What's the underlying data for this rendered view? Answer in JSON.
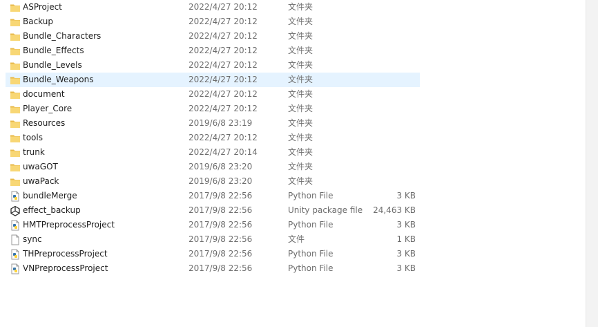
{
  "files": [
    {
      "name": "ASProject",
      "date": "2022/4/27 20:12",
      "type": "文件夹",
      "size": "",
      "icon": "folder-icon",
      "selected": false
    },
    {
      "name": "Backup",
      "date": "2022/4/27 20:12",
      "type": "文件夹",
      "size": "",
      "icon": "folder-icon",
      "selected": false
    },
    {
      "name": "Bundle_Characters",
      "date": "2022/4/27 20:12",
      "type": "文件夹",
      "size": "",
      "icon": "folder-icon",
      "selected": false
    },
    {
      "name": "Bundle_Effects",
      "date": "2022/4/27 20:12",
      "type": "文件夹",
      "size": "",
      "icon": "folder-icon",
      "selected": false
    },
    {
      "name": "Bundle_Levels",
      "date": "2022/4/27 20:12",
      "type": "文件夹",
      "size": "",
      "icon": "folder-icon",
      "selected": false
    },
    {
      "name": "Bundle_Weapons",
      "date": "2022/4/27 20:12",
      "type": "文件夹",
      "size": "",
      "icon": "folder-icon",
      "selected": true
    },
    {
      "name": "document",
      "date": "2022/4/27 20:12",
      "type": "文件夹",
      "size": "",
      "icon": "folder-icon",
      "selected": false
    },
    {
      "name": "Player_Core",
      "date": "2022/4/27 20:12",
      "type": "文件夹",
      "size": "",
      "icon": "folder-icon",
      "selected": false
    },
    {
      "name": "Resources",
      "date": "2019/6/8 23:19",
      "type": "文件夹",
      "size": "",
      "icon": "folder-icon",
      "selected": false
    },
    {
      "name": "tools",
      "date": "2022/4/27 20:12",
      "type": "文件夹",
      "size": "",
      "icon": "folder-icon",
      "selected": false
    },
    {
      "name": "trunk",
      "date": "2022/4/27 20:14",
      "type": "文件夹",
      "size": "",
      "icon": "folder-icon",
      "selected": false
    },
    {
      "name": "uwaGOT",
      "date": "2019/6/8 23:20",
      "type": "文件夹",
      "size": "",
      "icon": "folder-icon",
      "selected": false
    },
    {
      "name": "uwaPack",
      "date": "2019/6/8 23:20",
      "type": "文件夹",
      "size": "",
      "icon": "folder-icon",
      "selected": false
    },
    {
      "name": "bundleMerge",
      "date": "2017/9/8 22:56",
      "type": "Python File",
      "size": "3 KB",
      "icon": "python-file-icon",
      "selected": false
    },
    {
      "name": "effect_backup",
      "date": "2017/9/8 22:56",
      "type": "Unity package file",
      "size": "24,463 KB",
      "icon": "unity-icon",
      "selected": false
    },
    {
      "name": "HMTPreprocessProject",
      "date": "2017/9/8 22:56",
      "type": "Python File",
      "size": "3 KB",
      "icon": "python-file-icon",
      "selected": false
    },
    {
      "name": "sync",
      "date": "2017/9/8 22:56",
      "type": "文件",
      "size": "1 KB",
      "icon": "blank-file-icon",
      "selected": false
    },
    {
      "name": "THPreprocessProject",
      "date": "2017/9/8 22:56",
      "type": "Python File",
      "size": "3 KB",
      "icon": "python-file-icon",
      "selected": false
    },
    {
      "name": "VNPreprocessProject",
      "date": "2017/9/8 22:56",
      "type": "Python File",
      "size": "3 KB",
      "icon": "python-file-icon",
      "selected": false
    }
  ],
  "colors": {
    "selected_row": "#e5f3ff",
    "folder": "#f8d775",
    "folder_dark": "#e7b84a"
  }
}
